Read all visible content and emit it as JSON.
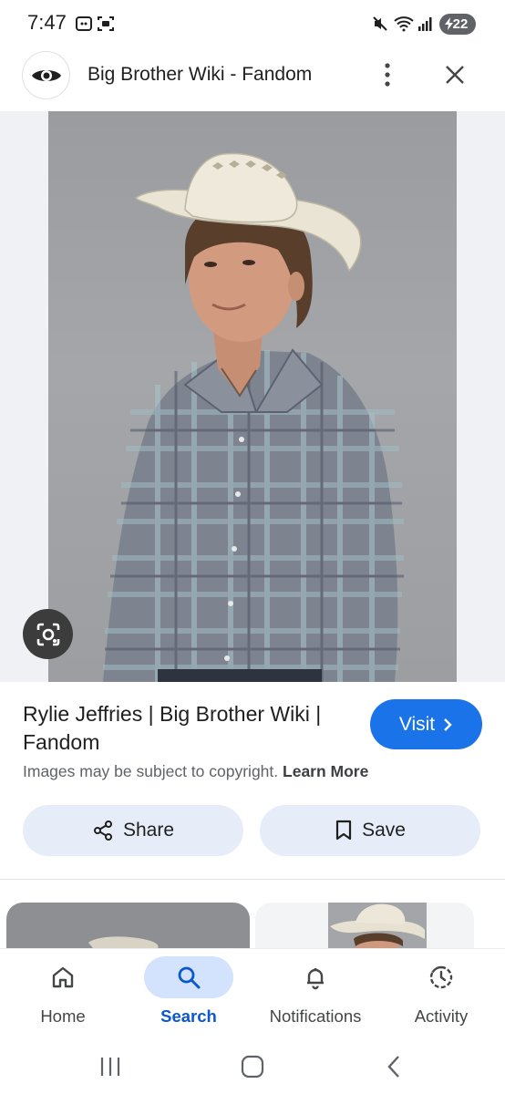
{
  "status_bar": {
    "time": "7:47",
    "battery": "22",
    "icons": [
      "screenshot-icon",
      "screen-capture-icon",
      "mute-icon",
      "wifi-icon",
      "signal-icon",
      "battery-charging-icon"
    ]
  },
  "header": {
    "site_title": "Big Brother Wiki - Fandom",
    "logo_icon": "eye-logo-icon",
    "menu_icon": "more-vert-icon",
    "close_icon": "close-icon"
  },
  "result": {
    "title": "Rylie Jeffries | Big Brother Wiki | Fandom",
    "visit_label": "Visit",
    "copyright_text": "Images may be subject to copyright.",
    "learn_more": "Learn More",
    "share_label": "Share",
    "save_label": "Save"
  },
  "bottom_nav": {
    "items": [
      {
        "label": "Home",
        "icon": "home-icon",
        "active": false
      },
      {
        "label": "Search",
        "icon": "search-icon",
        "active": true
      },
      {
        "label": "Notifications",
        "icon": "bell-icon",
        "active": false
      },
      {
        "label": "Activity",
        "icon": "activity-history-icon",
        "active": false
      }
    ]
  },
  "colors": {
    "accent": "#1a73e8",
    "active_nav": "#0b57d0",
    "active_pill": "#d3e3fd",
    "action_button_bg": "#e6edf9"
  }
}
